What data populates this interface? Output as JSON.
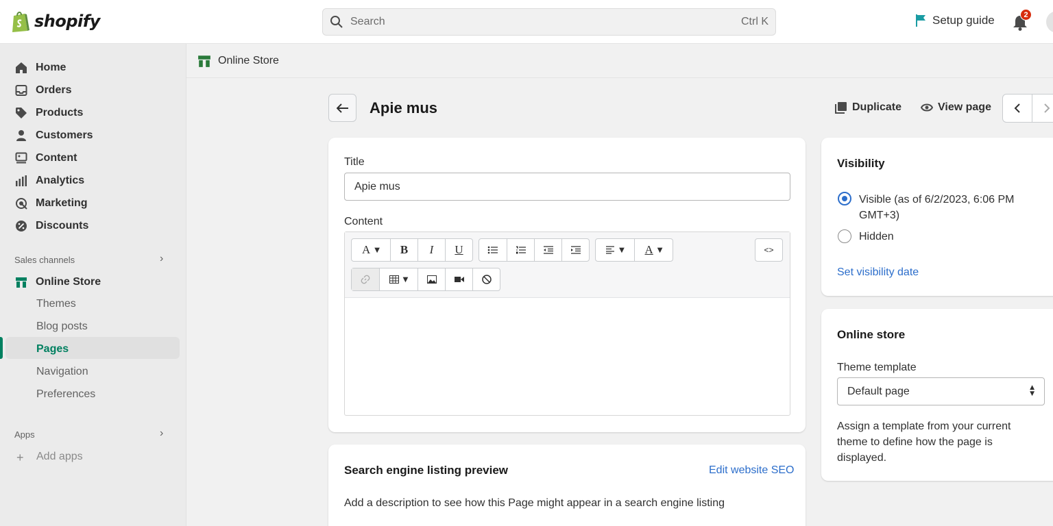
{
  "brand": {
    "name": "shopify",
    "accent": "#008060",
    "link_color": "#2c6ecb"
  },
  "topbar": {
    "search_placeholder": "Search",
    "search_shortcut": "Ctrl K",
    "setup_guide": "Setup guide",
    "notification_count": "2"
  },
  "sidebar": {
    "main_items": [
      {
        "label": "Home",
        "icon": "home-icon"
      },
      {
        "label": "Orders",
        "icon": "orders-icon"
      },
      {
        "label": "Products",
        "icon": "tag-icon"
      },
      {
        "label": "Customers",
        "icon": "person-icon"
      },
      {
        "label": "Content",
        "icon": "content-icon"
      },
      {
        "label": "Analytics",
        "icon": "analytics-icon"
      },
      {
        "label": "Marketing",
        "icon": "target-icon"
      },
      {
        "label": "Discounts",
        "icon": "discount-icon"
      }
    ],
    "sales_channels_title": "Sales channels",
    "online_store": "Online Store",
    "sub_items": [
      "Themes",
      "Blog posts",
      "Pages",
      "Navigation",
      "Preferences"
    ],
    "active_sub_item": "Pages",
    "apps_title": "Apps",
    "add_apps": "Add apps"
  },
  "breadcrumb": {
    "label": "Online Store"
  },
  "page": {
    "title": "Apie mus",
    "duplicate": "Duplicate",
    "view_page": "View page"
  },
  "editor_card": {
    "title_label": "Title",
    "title_value": "Apie mus",
    "content_label": "Content",
    "toolbar": {
      "font_glyph": "A",
      "bold": "B",
      "italic": "I",
      "underline": "U",
      "text_color_glyph": "A",
      "html_toggle": "<>"
    }
  },
  "seo_card": {
    "heading": "Search engine listing preview",
    "edit_link": "Edit website SEO",
    "description": "Add a description to see how this Page might appear in a search engine listing"
  },
  "visibility_card": {
    "heading": "Visibility",
    "visible_label": "Visible (as of 6/2/2023, 6:06 PM GMT+3)",
    "visible_line1": "Visible (as of 6/2/2023, 6:06 PM",
    "visible_line2": "GMT+3)",
    "hidden_label": "Hidden",
    "selected": "Visible",
    "set_date_link": "Set visibility date"
  },
  "online_store_card": {
    "heading": "Online store",
    "template_label": "Theme template",
    "template_value": "Default page",
    "help_text": "Assign a template from your current theme to define how the page is displayed.",
    "help_line1": "Assign a template from your current",
    "help_line2": "theme to define how the page is",
    "help_line3": "displayed."
  }
}
